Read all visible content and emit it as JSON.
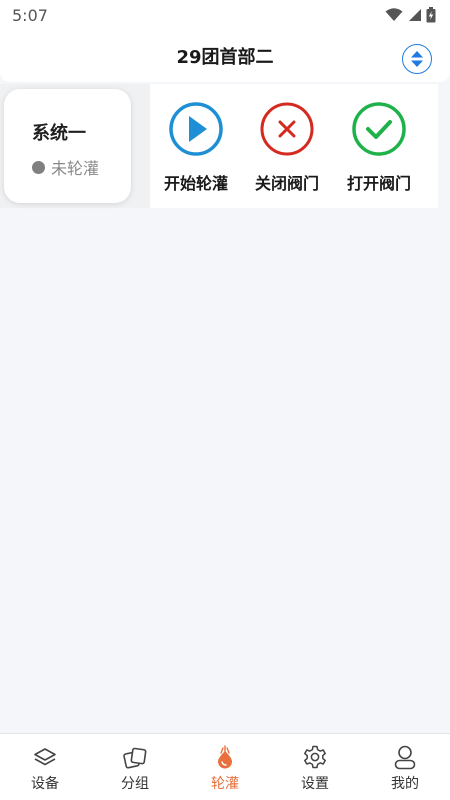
{
  "status_bar": {
    "time": "5:07"
  },
  "header": {
    "title": "29团首部二"
  },
  "system": {
    "name": "系统一",
    "status": "未轮灌"
  },
  "actions": [
    {
      "label": "开始轮灌",
      "icon": "play-icon",
      "color": "#1e8fd5"
    },
    {
      "label": "关闭阀门",
      "icon": "close-icon",
      "color": "#d42a20"
    },
    {
      "label": "打开阀门",
      "icon": "check-icon",
      "color": "#1fb24a"
    }
  ],
  "bottom_nav": [
    {
      "label": "设备",
      "icon": "layers-icon"
    },
    {
      "label": "分组",
      "icon": "group-icon"
    },
    {
      "label": "轮灌",
      "icon": "irrigation-icon",
      "active": true
    },
    {
      "label": "设置",
      "icon": "gear-icon"
    },
    {
      "label": "我的",
      "icon": "user-icon"
    }
  ],
  "colors": {
    "accent": "#e8703e",
    "primary": "#1f7be0",
    "background": "#f4f6f9"
  }
}
